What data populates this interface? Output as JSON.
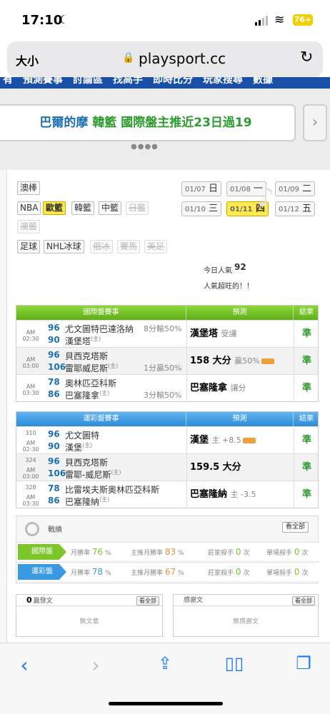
{
  "status": {
    "time": "17:10",
    "battery": "76+"
  },
  "browser": {
    "size_label": "大小",
    "url": "playsport.cc"
  },
  "nav_cut": "有　預測賽事　討論區　找高手　即時比分　玩家搜尋　數據",
  "marquee": {
    "prefix": "巴爾的摩",
    "mid": "韓籃",
    "text": "國際盤主推近23日過19"
  },
  "sports_tags": [
    {
      "label": "澳棒",
      "state": "normal"
    },
    {
      "label": "NBA",
      "state": "normal"
    },
    {
      "label": "歐籃",
      "state": "selected"
    },
    {
      "label": "韓籃",
      "state": "normal"
    },
    {
      "label": "中籃",
      "state": "normal"
    },
    {
      "label": "日籃",
      "state": "disabled"
    },
    {
      "label": "澳籃",
      "state": "disabled"
    },
    {
      "label": "足球",
      "state": "normal"
    },
    {
      "label": "NHL冰球",
      "state": "normal"
    },
    {
      "label": "俄冰",
      "state": "disabled"
    },
    {
      "label": "賽馬",
      "state": "disabled"
    },
    {
      "label": "美足",
      "state": "disabled"
    }
  ],
  "dates": [
    {
      "d": "01/07",
      "w": "日"
    },
    {
      "d": "01/08",
      "w": "一"
    },
    {
      "d": "01/09",
      "w": "二"
    },
    {
      "d": "01/10",
      "w": "三"
    },
    {
      "d": "01/11",
      "w": "四",
      "selected": true
    },
    {
      "d": "01/12",
      "w": "五"
    }
  ],
  "popularity": {
    "label": "今日人氣",
    "value": "92",
    "note": "人氣超旺的！！"
  },
  "intl": {
    "headers": {
      "event": "國際盤賽事",
      "pred": "預測",
      "result": "結果"
    },
    "rows": [
      {
        "ampm": "AM",
        "time": "02:30",
        "n1": "96",
        "t1": "尤文圖特巴達洛納",
        "n2": "90",
        "t2": "漢堡塔",
        "t2_tag": "(主)",
        "odds": "8分輸50%",
        "odds_row": 1,
        "pred": "漢堡塔",
        "pred_sub": "受讓",
        "icon": false,
        "result": "準"
      },
      {
        "ampm": "AM",
        "time": "03:00",
        "n1": "96",
        "t1": "貝西克塔斯",
        "n2": "106",
        "t2": "雷耶威尼斯",
        "t2_tag": "(主)",
        "odds": "1分贏50%",
        "odds_row": 2,
        "pred": "158 大分",
        "pred_sub": "贏50%",
        "icon": true,
        "result": "準"
      },
      {
        "ampm": "AM",
        "time": "03:30",
        "n1": "78",
        "t1": "奧林匹亞科斯",
        "n2": "86",
        "t2": "巴塞隆拿",
        "t2_tag": "(主)",
        "odds": "3分輸50%",
        "odds_row": 2,
        "pred": "巴塞隆拿",
        "pred_sub": "讓分",
        "icon": false,
        "result": "準"
      }
    ]
  },
  "lottery": {
    "headers": {
      "event": "運彩盤賽事",
      "pred": "預測",
      "result": "結果"
    },
    "rows": [
      {
        "no": "310",
        "ampm": "AM",
        "time": "02:30",
        "n1": "96",
        "t1": "尤文圖特",
        "n2": "90",
        "t2": "漢堡",
        "t2_tag": "(主)",
        "pred": "漢堡",
        "pred_sub": "主 +8.5",
        "icon": true,
        "result": "準"
      },
      {
        "no": "324",
        "ampm": "AM",
        "time": "03:00",
        "n1": "96",
        "t1": "貝西克塔斯",
        "n2": "106",
        "t2": "雷耶-威尼斯",
        "t2_tag": "(主)",
        "pred": "159.5 大分",
        "pred_sub": "",
        "icon": false,
        "result": "準"
      },
      {
        "no": "328",
        "ampm": "AM",
        "time": "03:30",
        "n1": "78",
        "t1": "比雷埃夫斯奧林匹亞科斯",
        "n2": "86",
        "t2": "巴塞隆納",
        "t2_tag": "(主)",
        "pred": "巴塞隆納",
        "pred_sub": "主 -3.5",
        "icon": false,
        "result": "準"
      }
    ]
  },
  "stats": {
    "title": "戰績",
    "more": "看全部",
    "rows": [
      {
        "badge": "國際盤",
        "monthly_label": "月勝率",
        "monthly": "76",
        "main_label": "主推月勝率",
        "main": "83",
        "killer_label": "莊家殺手",
        "killer": "0",
        "single_label": "單場殺手",
        "single": "0",
        "unit": "次",
        "pct": "%"
      },
      {
        "badge": "運彩盤",
        "monthly_label": "月勝率",
        "monthly": "78",
        "main_label": "主推月勝率",
        "main": "67",
        "killer_label": "莊家殺手",
        "killer": "0",
        "single_label": "單場殺手",
        "single": "0",
        "unit": "次",
        "pct": "%"
      }
    ]
  },
  "posts": {
    "count": "0",
    "label": "篇發文",
    "more": "看全部",
    "empty": "無文章"
  },
  "thanks": {
    "label": "感謝文",
    "more": "看全部",
    "empty": "無感謝文"
  },
  "colors": {
    "green": "#7cc62c",
    "blue": "#3a9ae0",
    "orange": "#e9933b",
    "ios_blue": "#1a7cf5"
  }
}
